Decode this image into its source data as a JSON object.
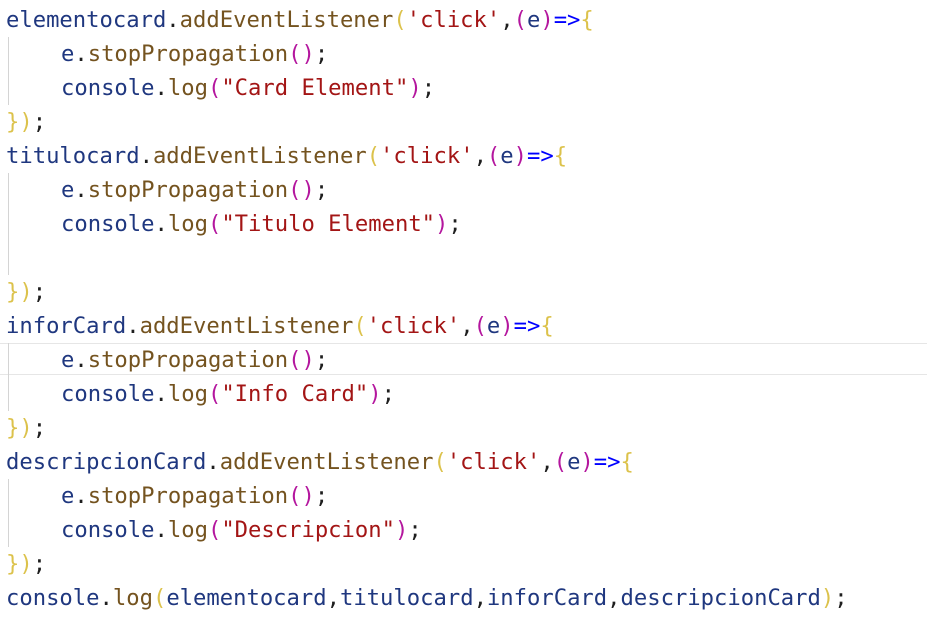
{
  "editor": {
    "current_line": 10,
    "lines": [
      {
        "tokens": [
          {
            "t": "obj",
            "v": "elementocard"
          },
          {
            "t": "punct",
            "v": "."
          },
          {
            "t": "method",
            "v": "addEventListener"
          },
          {
            "t": "brace1",
            "v": "("
          },
          {
            "t": "str",
            "v": "'click'"
          },
          {
            "t": "punct",
            "v": ","
          },
          {
            "t": "paren2",
            "v": "("
          },
          {
            "t": "param",
            "v": "e"
          },
          {
            "t": "paren2",
            "v": ")"
          },
          {
            "t": "arrow",
            "v": "=>"
          },
          {
            "t": "brace1",
            "v": "{"
          }
        ]
      },
      {
        "indent": true,
        "tokens": [
          {
            "t": "param",
            "v": "e"
          },
          {
            "t": "punct",
            "v": "."
          },
          {
            "t": "method",
            "v": "stopPropagation"
          },
          {
            "t": "paren2",
            "v": "()"
          },
          {
            "t": "punct",
            "v": ";"
          }
        ]
      },
      {
        "indent": true,
        "tokens": [
          {
            "t": "obj",
            "v": "console"
          },
          {
            "t": "punct",
            "v": "."
          },
          {
            "t": "method",
            "v": "log"
          },
          {
            "t": "paren2",
            "v": "("
          },
          {
            "t": "str",
            "v": "\"Card Element\""
          },
          {
            "t": "paren2",
            "v": ")"
          },
          {
            "t": "punct",
            "v": ";"
          }
        ]
      },
      {
        "tokens": [
          {
            "t": "brace1",
            "v": "})"
          },
          {
            "t": "punct",
            "v": ";"
          }
        ]
      },
      {
        "tokens": [
          {
            "t": "obj",
            "v": "titulocard"
          },
          {
            "t": "punct",
            "v": "."
          },
          {
            "t": "method",
            "v": "addEventListener"
          },
          {
            "t": "brace1",
            "v": "("
          },
          {
            "t": "str",
            "v": "'click'"
          },
          {
            "t": "punct",
            "v": ","
          },
          {
            "t": "paren2",
            "v": "("
          },
          {
            "t": "param",
            "v": "e"
          },
          {
            "t": "paren2",
            "v": ")"
          },
          {
            "t": "arrow",
            "v": "=>"
          },
          {
            "t": "brace1",
            "v": "{"
          }
        ]
      },
      {
        "indent": true,
        "tokens": [
          {
            "t": "param",
            "v": "e"
          },
          {
            "t": "punct",
            "v": "."
          },
          {
            "t": "method",
            "v": "stopPropagation"
          },
          {
            "t": "paren2",
            "v": "()"
          },
          {
            "t": "punct",
            "v": ";"
          }
        ]
      },
      {
        "indent": true,
        "tokens": [
          {
            "t": "obj",
            "v": "console"
          },
          {
            "t": "punct",
            "v": "."
          },
          {
            "t": "method",
            "v": "log"
          },
          {
            "t": "paren2",
            "v": "("
          },
          {
            "t": "str",
            "v": "\"Titulo Element\""
          },
          {
            "t": "paren2",
            "v": ")"
          },
          {
            "t": "punct",
            "v": ";"
          }
        ]
      },
      {
        "tokens": []
      },
      {
        "tokens": [
          {
            "t": "brace1",
            "v": "})"
          },
          {
            "t": "punct",
            "v": ";"
          }
        ]
      },
      {
        "tokens": [
          {
            "t": "obj",
            "v": "inforCard"
          },
          {
            "t": "punct",
            "v": "."
          },
          {
            "t": "method",
            "v": "addEventListener"
          },
          {
            "t": "brace1",
            "v": "("
          },
          {
            "t": "str",
            "v": "'click'"
          },
          {
            "t": "punct",
            "v": ","
          },
          {
            "t": "paren2",
            "v": "("
          },
          {
            "t": "param",
            "v": "e"
          },
          {
            "t": "paren2",
            "v": ")"
          },
          {
            "t": "arrow",
            "v": "=>"
          },
          {
            "t": "brace1",
            "v": "{"
          }
        ]
      },
      {
        "indent": true,
        "tokens": [
          {
            "t": "param",
            "v": "e"
          },
          {
            "t": "punct",
            "v": "."
          },
          {
            "t": "method",
            "v": "stopPropagation"
          },
          {
            "t": "paren2",
            "v": "()"
          },
          {
            "t": "punct",
            "v": ";"
          }
        ]
      },
      {
        "indent": true,
        "tokens": [
          {
            "t": "obj",
            "v": "console"
          },
          {
            "t": "punct",
            "v": "."
          },
          {
            "t": "method",
            "v": "log"
          },
          {
            "t": "paren2",
            "v": "("
          },
          {
            "t": "str",
            "v": "\"Info Card\""
          },
          {
            "t": "paren2",
            "v": ")"
          },
          {
            "t": "punct",
            "v": ";"
          }
        ]
      },
      {
        "tokens": [
          {
            "t": "brace1",
            "v": "})"
          },
          {
            "t": "punct",
            "v": ";"
          }
        ]
      },
      {
        "tokens": [
          {
            "t": "obj",
            "v": "descripcionCard"
          },
          {
            "t": "punct",
            "v": "."
          },
          {
            "t": "method",
            "v": "addEventListener"
          },
          {
            "t": "brace1",
            "v": "("
          },
          {
            "t": "str",
            "v": "'click'"
          },
          {
            "t": "punct",
            "v": ","
          },
          {
            "t": "paren2",
            "v": "("
          },
          {
            "t": "param",
            "v": "e"
          },
          {
            "t": "paren2",
            "v": ")"
          },
          {
            "t": "arrow",
            "v": "=>"
          },
          {
            "t": "brace1",
            "v": "{"
          }
        ]
      },
      {
        "indent": true,
        "tokens": [
          {
            "t": "param",
            "v": "e"
          },
          {
            "t": "punct",
            "v": "."
          },
          {
            "t": "method",
            "v": "stopPropagation"
          },
          {
            "t": "paren2",
            "v": "()"
          },
          {
            "t": "punct",
            "v": ";"
          }
        ]
      },
      {
        "indent": true,
        "tokens": [
          {
            "t": "obj",
            "v": "console"
          },
          {
            "t": "punct",
            "v": "."
          },
          {
            "t": "method",
            "v": "log"
          },
          {
            "t": "paren2",
            "v": "("
          },
          {
            "t": "str",
            "v": "\"Descripcion\""
          },
          {
            "t": "paren2",
            "v": ")"
          },
          {
            "t": "punct",
            "v": ";"
          }
        ]
      },
      {
        "tokens": [
          {
            "t": "brace1",
            "v": "})"
          },
          {
            "t": "punct",
            "v": ";"
          }
        ]
      },
      {
        "tokens": [
          {
            "t": "obj",
            "v": "console"
          },
          {
            "t": "punct",
            "v": "."
          },
          {
            "t": "method",
            "v": "log"
          },
          {
            "t": "brace1",
            "v": "("
          },
          {
            "t": "param",
            "v": "elementocard"
          },
          {
            "t": "punct",
            "v": ","
          },
          {
            "t": "param",
            "v": "titulocard"
          },
          {
            "t": "punct",
            "v": ","
          },
          {
            "t": "param",
            "v": "inforCard"
          },
          {
            "t": "punct",
            "v": ","
          },
          {
            "t": "param",
            "v": "descripcionCard"
          },
          {
            "t": "brace1",
            "v": ")"
          },
          {
            "t": "punct",
            "v": ";"
          }
        ]
      }
    ]
  }
}
